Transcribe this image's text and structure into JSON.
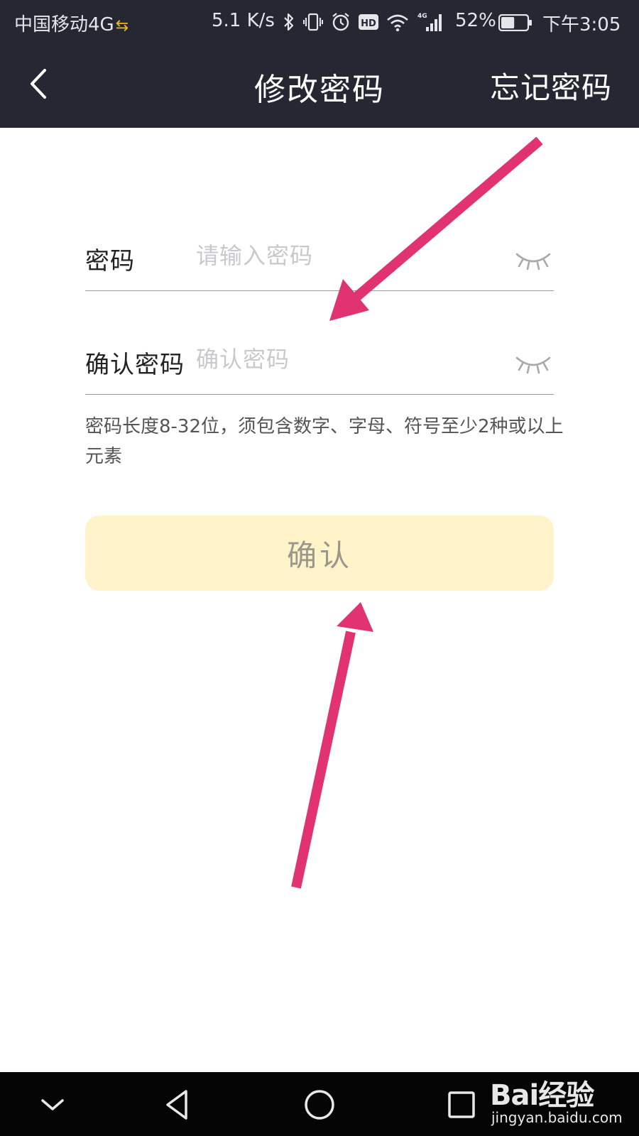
{
  "status_bar": {
    "carrier": "中国移动4G",
    "network_speed": "5.1 K/s",
    "signal_label": "4G",
    "battery_percent": "52%",
    "battery_level": 0.52,
    "time": "下午3:05",
    "icons": [
      "bluetooth-icon",
      "vibrate-icon",
      "alarm-icon",
      "hd-icon",
      "wifi-icon",
      "signal-icon",
      "battery-icon"
    ]
  },
  "header": {
    "title": "修改密码",
    "forgot_label": "忘记密码",
    "back_icon": "chevron-left-icon"
  },
  "form": {
    "password": {
      "label": "密码",
      "placeholder": "请输入密码",
      "value": ""
    },
    "confirm_password": {
      "label": "确认密码",
      "placeholder": "确认密码",
      "value": ""
    },
    "hint": "密码长度8-32位，须包含数字、字母、符号至少2种或以上元素",
    "confirm_button_label": "确认"
  },
  "colors": {
    "header_bg": "#252733",
    "button_bg": "#fff3c9",
    "button_text": "#9c978c",
    "annotation_arrow": "#e0336f",
    "system_nav_bg": "#050505"
  },
  "watermark": {
    "logo": "Bai经验",
    "url": "jingyan.baidu.com"
  }
}
